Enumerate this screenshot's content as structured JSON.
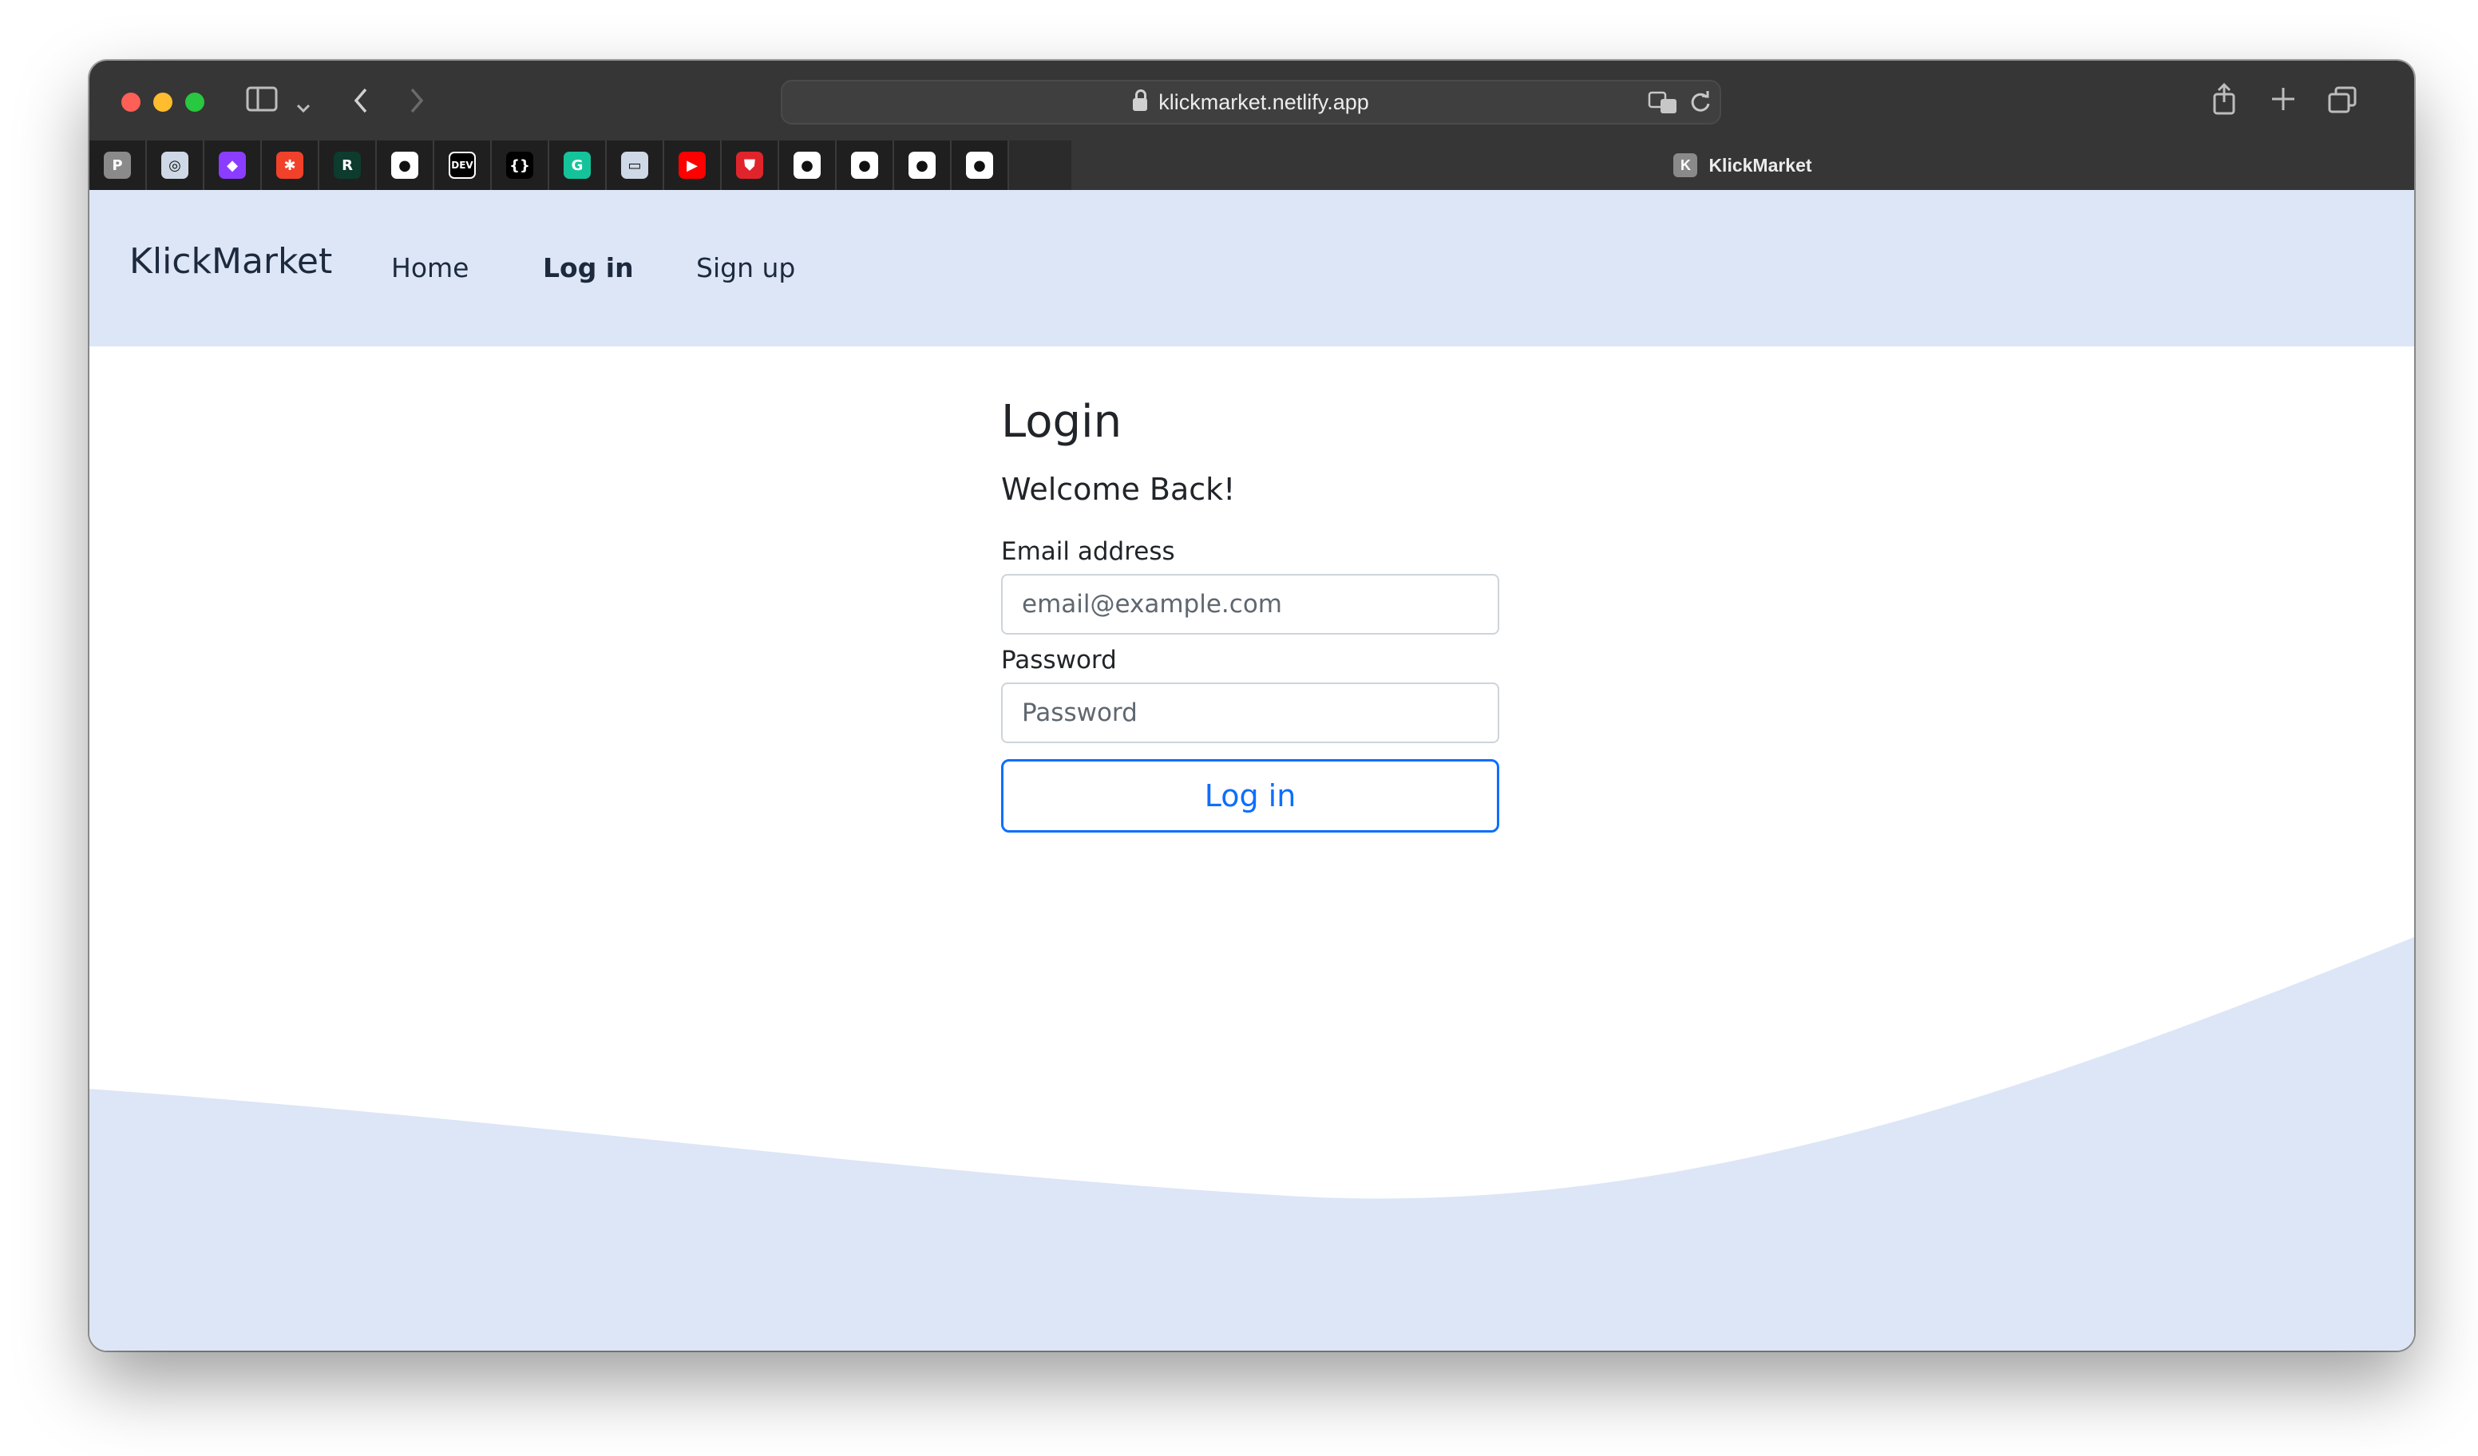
{
  "browser": {
    "url": "klickmarket.netlify.app",
    "tab_title": "KlickMarket",
    "tab_favicon_letter": "K",
    "favorites": [
      {
        "icon": "pocket-icon",
        "glyph": "P",
        "color": "#8a8a8a"
      },
      {
        "icon": "app-icon",
        "glyph": "◎",
        "color": "#cfd8e6"
      },
      {
        "icon": "purple-app-icon",
        "glyph": "◆",
        "color": "#8b3dff"
      },
      {
        "icon": "asterisk-icon",
        "glyph": "✱",
        "color": "#f2412a"
      },
      {
        "icon": "rn-icon",
        "glyph": "R",
        "color": "#0d3b2e"
      },
      {
        "icon": "github-icon",
        "glyph": "●",
        "color": "#ffffff"
      },
      {
        "icon": "dev-icon",
        "glyph": "DEV",
        "color": "#000000"
      },
      {
        "icon": "code-icon",
        "glyph": "{}",
        "color": "#000000"
      },
      {
        "icon": "grammarly-icon",
        "glyph": "G",
        "color": "#15c39a"
      },
      {
        "icon": "app-icon-2",
        "glyph": "▭",
        "color": "#cfd8e6"
      },
      {
        "icon": "youtube-icon",
        "glyph": "▶",
        "color": "#ff0000"
      },
      {
        "icon": "shield-icon",
        "glyph": "⛊",
        "color": "#e0242b"
      },
      {
        "icon": "github-icon",
        "glyph": "●",
        "color": "#ffffff"
      },
      {
        "icon": "github-icon",
        "glyph": "●",
        "color": "#ffffff"
      },
      {
        "icon": "github-icon",
        "glyph": "●",
        "color": "#ffffff"
      },
      {
        "icon": "github-icon",
        "glyph": "●",
        "color": "#ffffff"
      }
    ]
  },
  "navbar": {
    "brand": "KlickMarket",
    "links": [
      "Home",
      "Log in",
      "Sign up"
    ],
    "active": "Log in"
  },
  "form": {
    "title": "Login",
    "subtitle": "Welcome Back!",
    "email_label": "Email address",
    "email_placeholder": "email@example.com",
    "password_label": "Password",
    "password_placeholder": "Password",
    "submit_label": "Log in"
  },
  "colors": {
    "accent": "#0d6efd",
    "navbar_bg": "#dce6f7",
    "wave": "#dce6f7"
  }
}
